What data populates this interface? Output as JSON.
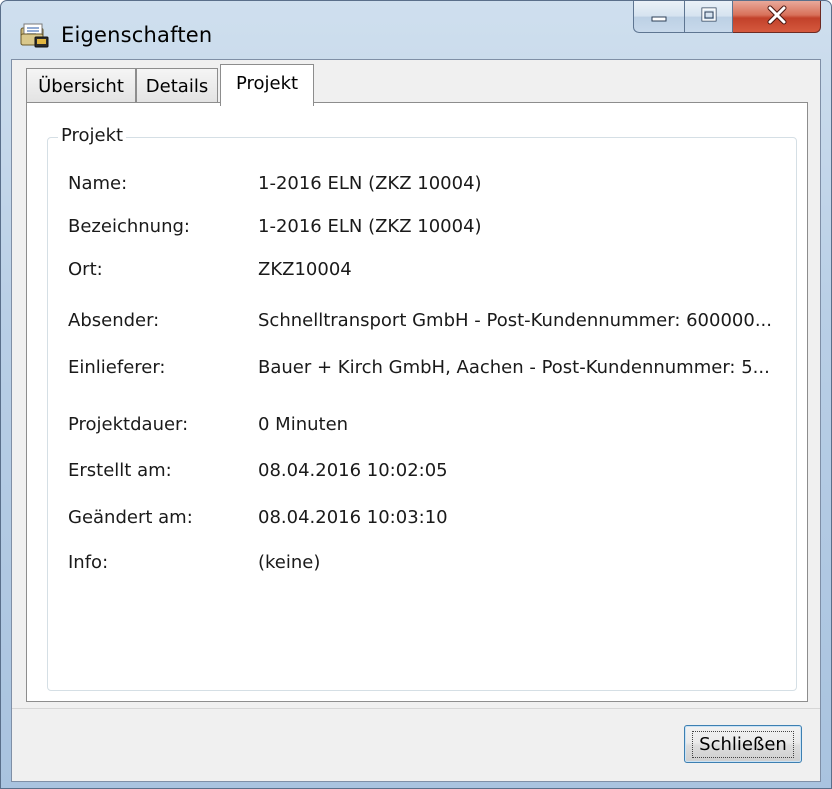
{
  "window": {
    "title": "Eigenschaften",
    "accent_color": "#c2412a"
  },
  "tabs": [
    {
      "label": "Übersicht",
      "active": false
    },
    {
      "label": "Details",
      "active": false
    },
    {
      "label": "Projekt",
      "active": true
    }
  ],
  "group": {
    "legend": "Projekt",
    "fields": [
      {
        "label": "Name:",
        "value": "1-2016 ELN  (ZKZ 10004)"
      },
      {
        "label": "Bezeichnung:",
        "value": "1-2016 ELN  (ZKZ 10004)"
      },
      {
        "label": "Ort:",
        "value": "ZKZ10004"
      },
      {
        "label": "Absender:",
        "value": "Schnelltransport GmbH - Post-Kundennummer: 600000..."
      },
      {
        "label": "Einlieferer:",
        "value": "Bauer + Kirch GmbH, Aachen - Post-Kundennummer: 5..."
      },
      {
        "label": "Projektdauer:",
        "value": "0 Minuten"
      },
      {
        "label": "Erstellt am:",
        "value": "08.04.2016 10:02:05"
      },
      {
        "label": "Geändert am:",
        "value": "08.04.2016 10:03:10"
      },
      {
        "label": "Info:",
        "value": "(keine)"
      }
    ]
  },
  "footer": {
    "close_label": "Schließen"
  },
  "icons": {
    "app": "properties-icon",
    "minimize": "minimize-icon",
    "maximize": "maximize-icon",
    "close": "close-icon"
  }
}
